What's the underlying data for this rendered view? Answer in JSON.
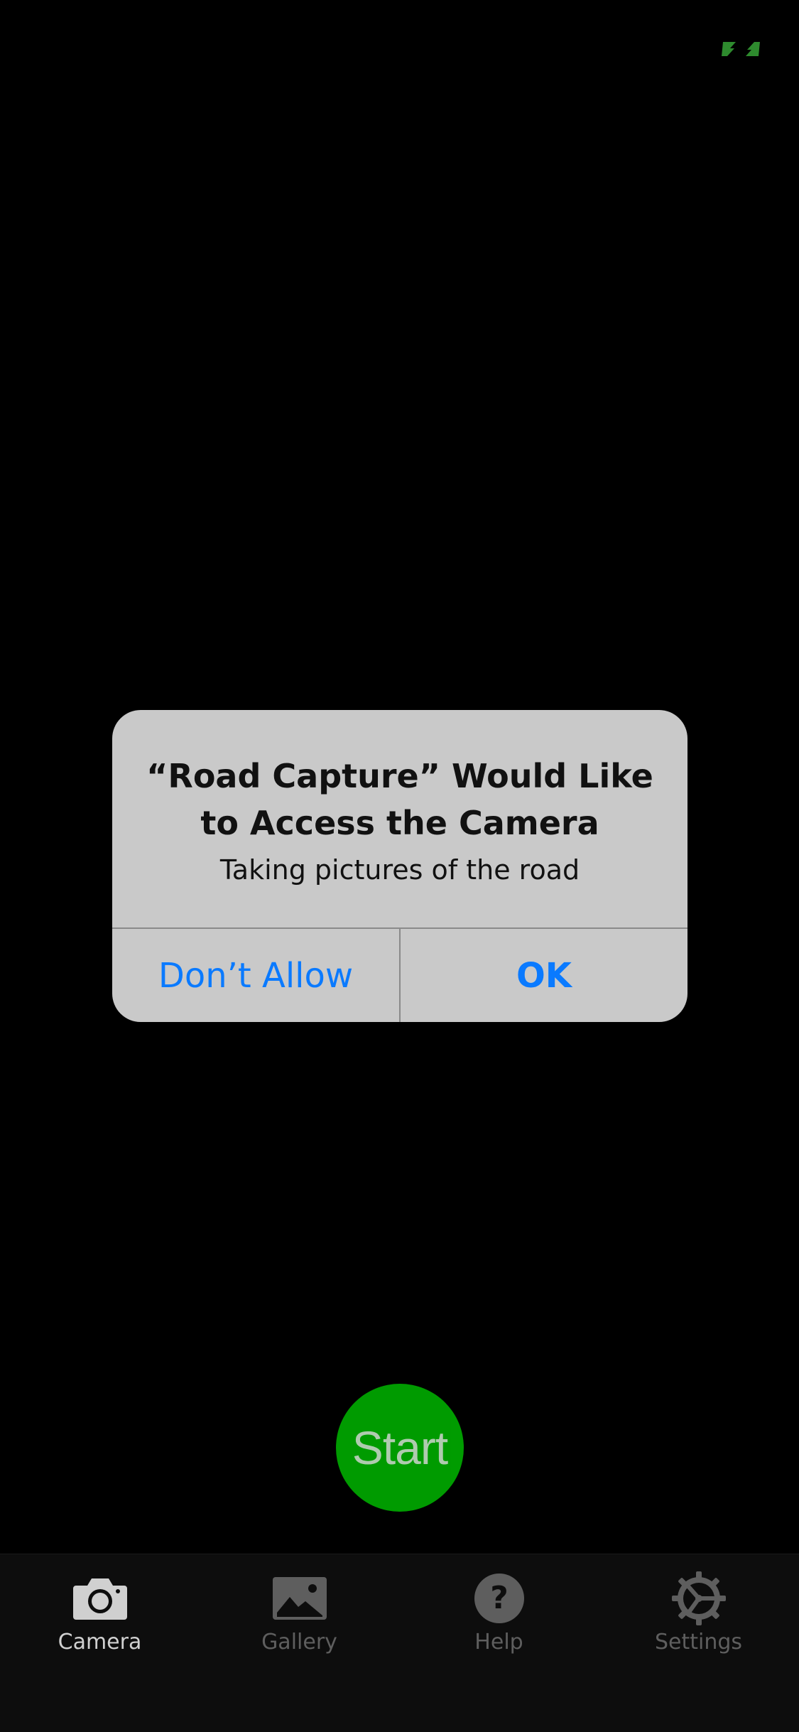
{
  "alert": {
    "title": "“Road Capture” Would Like to Access the Camera",
    "message": "Taking pictures of the road",
    "dont_allow_label": "Don’t Allow",
    "ok_label": "OK"
  },
  "camera": {
    "start_label": "Start"
  },
  "tabs": [
    {
      "label": "Camera",
      "icon": "camera-icon",
      "active": true
    },
    {
      "label": "Gallery",
      "icon": "image-icon",
      "active": false
    },
    {
      "label": "Help",
      "icon": "question-icon",
      "active": false
    },
    {
      "label": "Settings",
      "icon": "gear-icon",
      "active": false
    }
  ],
  "colors": {
    "accent": "#0a7aff",
    "start_button": "#00a400",
    "flip_icon": "#2e8b2e",
    "tab_active": "#d0d0d0",
    "tab_inactive": "#5e5e5e"
  }
}
